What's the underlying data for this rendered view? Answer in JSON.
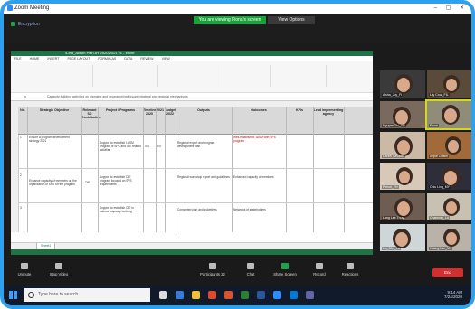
{
  "zoom": {
    "window_title": "Zoom Meeting",
    "share_banner": "You are viewing Fiona's screen",
    "view_options": "View Options",
    "security_label": "Encryption"
  },
  "excel": {
    "file_title": "4-Ind_Action Plan AY 2020-2021 v1 - Excel",
    "tabs": [
      "FILE",
      "HOME",
      "INSERT",
      "PAGE LAYOUT",
      "FORMULAS",
      "DATA",
      "REVIEW",
      "VIEW"
    ],
    "formula_text": "Capacity-building activities on planning and programming through bilateral and regional mechanisms",
    "headers": [
      "No.",
      "Strategic Objective",
      "Relevant SD Contribution",
      "Project / Programs",
      "Timeline 2020",
      "2021",
      "Budget 2022",
      "Outputs",
      "Outcomes",
      "KPIs",
      "Lead implementing agency"
    ],
    "rows": [
      {
        "no": "1",
        "objective": "Ensure a program development strategy 2021",
        "contribution": "",
        "project": "Support to establish 1ASM program of SPS and OIE related activities",
        "t2020": "X/X",
        "t2021": "X/X",
        "outputs": "Regional expert and program development plan",
        "outcomes": "Well-established 1ASM with SPS program"
      },
      {
        "no": "2",
        "objective": "Enhance capacity of members on the organization of SPS for the program",
        "contribution": "OIE",
        "project": "Support to establish OIE program focused on SPS requirements",
        "t2020": "",
        "t2021": "",
        "outputs": "Regional workshop report and guidelines",
        "outcomes": "Enhanced capacity of members"
      },
      {
        "no": "3",
        "objective": "",
        "contribution": "",
        "project": "Support to establish OIE in national capacity building",
        "t2020": "",
        "t2021": "",
        "outputs": "Completed plan and guidelines",
        "outcomes": "Networks of stakeholders"
      }
    ],
    "sheet_tab": "Sheet1"
  },
  "participants": [
    {
      "name": "Aisha_Joy_FI"
    },
    {
      "name": "Lily Cruz_FIL"
    },
    {
      "name": "Nguyen Thi_VN"
    },
    {
      "name": "Fiona"
    },
    {
      "name": "Daniel Cavalier"
    },
    {
      "name": "Apple Gustin"
    },
    {
      "name": "Pensri_TH"
    },
    {
      "name": "Chiu Ling_MY"
    },
    {
      "name": "Lang Lee Thuy"
    },
    {
      "name": "Chanmay_LA"
    },
    {
      "name": "Lia_Ahn_LA"
    },
    {
      "name": "Hoang Lan_VN"
    }
  ],
  "toolbar": {
    "mute": "Unmute",
    "video": "Stop Video",
    "participants": "Participants",
    "participants_count": "22",
    "chat": "Chat",
    "share": "Share Screen",
    "record": "Record",
    "reactions": "Reactions",
    "end": "End"
  },
  "taskbar": {
    "search_placeholder": "Type here to search",
    "time": "9:14 AM",
    "date": "7/24/2020"
  },
  "colors": {
    "frame": "#2ea0f0",
    "excel_green": "#217346",
    "share_green": "#18a33a",
    "end_red": "#d32f2f"
  }
}
